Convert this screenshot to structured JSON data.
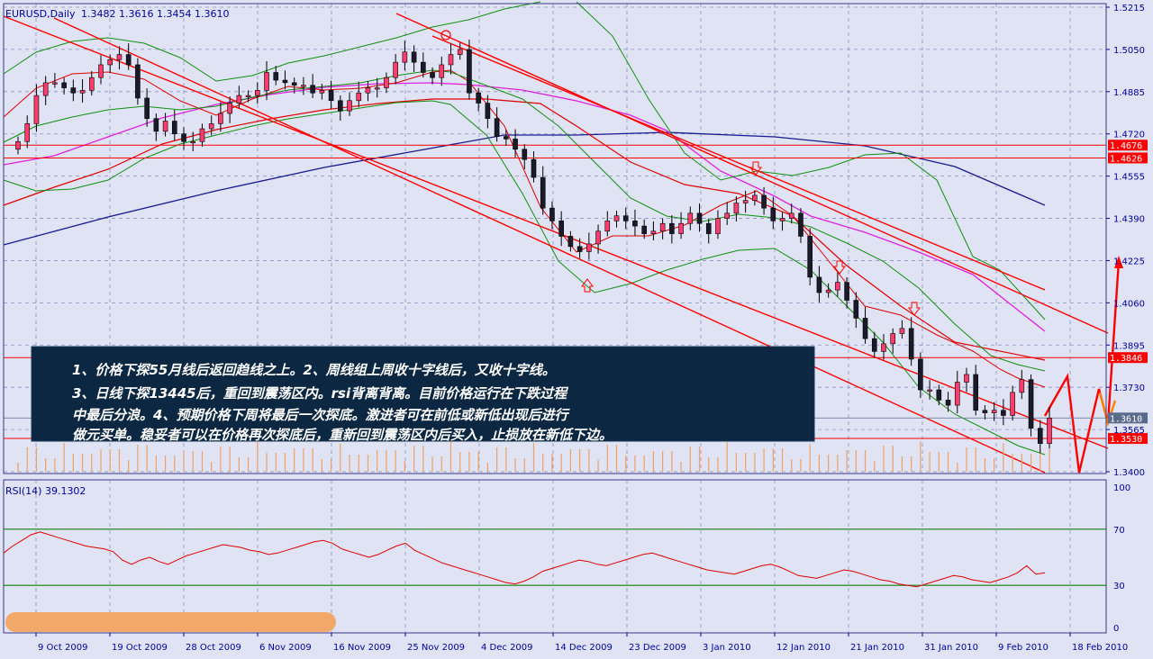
{
  "chart_data": [
    {
      "type": "candlestick",
      "title": "EURUSD,Daily",
      "ohlc_text": "1.3482 1.3616 1.3454 1.3610",
      "y_ticks": [
        "1.5215",
        "1.5050",
        "1.4885",
        "1.4720",
        "1.4555",
        "1.4390",
        "1.4225",
        "1.4060",
        "1.3895",
        "1.3730",
        "1.3565",
        "1.3400"
      ],
      "ylim": [
        1.34,
        1.5215
      ],
      "price_tags": [
        {
          "label": "1.4676",
          "value": 1.4676,
          "color": "#ff0000"
        },
        {
          "label": "1.4626",
          "value": 1.4626,
          "color": "#ff0000"
        },
        {
          "label": "1.3846",
          "value": 1.3846,
          "color": "#ff0000"
        },
        {
          "label": "1.3610",
          "value": 1.361,
          "color": "#5a6a8a"
        },
        {
          "label": "1.3530",
          "value": 1.353,
          "color": "#ff0000"
        }
      ],
      "x_labels": [
        "9 Oct 2009",
        "19 Oct 2009",
        "28 Oct 2009",
        "6 Nov 2009",
        "16 Nov 2009",
        "25 Nov 2009",
        "4 Dec 2009",
        "14 Dec 2009",
        "23 Dec 2009",
        "3 Jan 2010",
        "12 Jan 2010",
        "21 Jan 2010",
        "31 Jan 2010",
        "9 Feb 2010",
        "18 Feb 2010"
      ],
      "series_close": [
        1.469,
        1.476,
        1.487,
        1.492,
        1.492,
        1.49,
        1.488,
        1.489,
        1.494,
        1.499,
        1.501,
        1.503,
        1.499,
        1.486,
        1.478,
        1.473,
        1.477,
        1.472,
        1.469,
        1.469,
        1.474,
        1.476,
        1.48,
        1.484,
        1.487,
        1.487,
        1.489,
        1.496,
        1.493,
        1.492,
        1.491,
        1.491,
        1.488,
        1.489,
        1.485,
        1.481,
        1.485,
        1.488,
        1.49,
        1.49,
        1.494,
        1.5,
        1.504,
        1.5,
        1.496,
        1.494,
        1.499,
        1.503,
        1.505,
        1.488,
        1.484,
        1.478,
        1.471,
        1.47,
        1.466,
        1.462,
        1.455,
        1.443,
        1.438,
        1.432,
        1.428,
        1.426,
        1.429,
        1.434,
        1.438,
        1.44,
        1.438,
        1.436,
        1.433,
        1.434,
        1.437,
        1.433,
        1.437,
        1.441,
        1.437,
        1.433,
        1.439,
        1.441,
        1.445,
        1.446,
        1.448,
        1.443,
        1.438,
        1.439,
        1.441,
        1.432,
        1.416,
        1.41,
        1.411,
        1.414,
        1.407,
        1.4,
        1.392,
        1.387,
        1.39,
        1.394,
        1.396,
        1.384,
        1.372,
        1.372,
        1.368,
        1.366,
        1.375,
        1.378,
        1.364,
        1.363,
        1.364,
        1.362,
        1.371,
        1.376,
        1.357,
        1.351,
        1.361
      ],
      "annotation_lines": [
        "1、价格下探55月线后返回趋线之上。2、周线组上周收十字线后，又收十字线。",
        "3、日线下探13445后，重回到震荡区内。rsi背离背离。目前价格运行在下跌过程",
        "中最后分浪。4、预期价格下周将最后一次探底。激进者可在前低或新低出现后进行",
        "做元买单。稳妥者可以在价格再次探底后，重新回到震荡区内后买入，止损放在新低下边。"
      ]
    },
    {
      "type": "line",
      "title": "RSI(14) 39.1302",
      "y_ticks": [
        "100",
        "70",
        "30",
        "0"
      ],
      "ylim": [
        0,
        100
      ],
      "levels": [
        70,
        30
      ],
      "values": [
        53,
        58,
        62,
        66,
        68,
        66,
        64,
        62,
        60,
        58,
        57,
        56,
        54,
        48,
        45,
        48,
        50,
        47,
        45,
        48,
        51,
        53,
        55,
        57,
        59,
        58,
        57,
        55,
        54,
        52,
        53,
        55,
        57,
        59,
        61,
        62,
        60,
        56,
        54,
        52,
        50,
        52,
        55,
        58,
        60,
        55,
        52,
        49,
        46,
        44,
        42,
        40,
        38,
        36,
        34,
        32,
        31,
        33,
        36,
        40,
        42,
        44,
        46,
        48,
        47,
        45,
        44,
        46,
        48,
        50,
        52,
        53,
        51,
        49,
        47,
        45,
        43,
        41,
        40,
        39,
        38,
        40,
        42,
        44,
        45,
        43,
        40,
        37,
        36,
        35,
        37,
        39,
        41,
        40,
        38,
        36,
        34,
        33,
        31,
        30,
        29,
        31,
        33,
        35,
        37,
        36,
        34,
        33,
        32,
        34,
        36,
        39,
        44,
        38,
        39
      ]
    }
  ]
}
